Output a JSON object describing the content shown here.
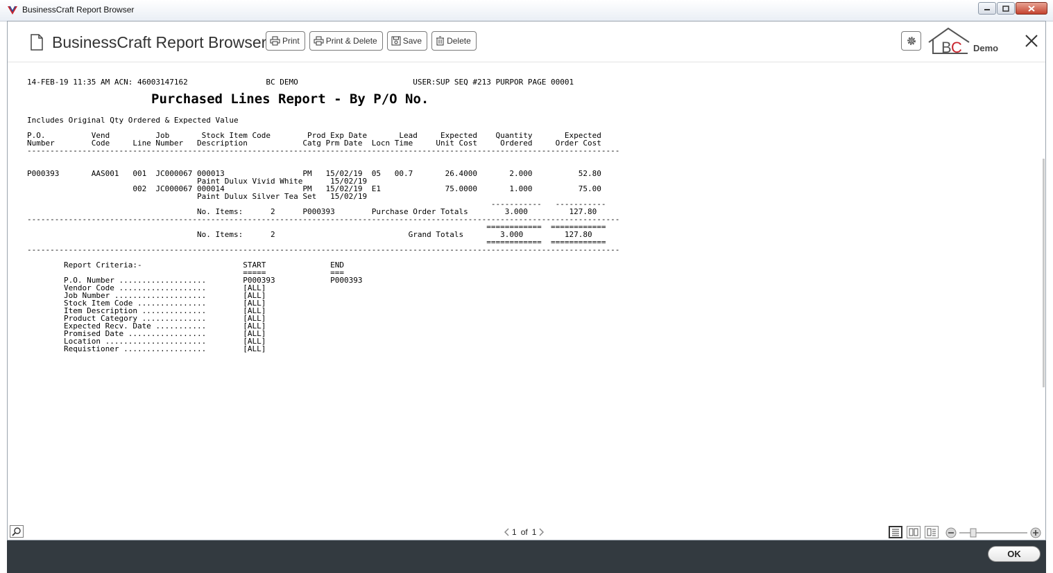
{
  "window": {
    "title": "BusinessCraft Report Browser"
  },
  "header": {
    "app_title": "BusinessCraft Report Browser",
    "toolbar": {
      "print": "Print",
      "print_delete": "Print & Delete",
      "save": "Save",
      "delete": "Delete"
    },
    "logo_text": "Demo",
    "logo_letters": "BC"
  },
  "report": {
    "title": "Purchased Lines Report - By P/O No.",
    "lines": [
      "14-FEB-19 11:35 AM ACN: 46003147162                 BC DEMO                         USER:SUP SEQ #213 PURPOR PAGE 00001",
      "",
      "",
      "",
      "",
      "Includes Original Qty Ordered & Expected Value",
      "",
      "P.O.          Vend          Job       Stock Item Code        Prod Exp Date       Lead     Expected    Quantity       Expected",
      "Number        Code     Line Number   Description            Catg Prm Date  Locn Time     Unit Cost     Ordered     Order Cost",
      "---------------------------------------------------------------------------------------------------------------------------------",
      "",
      "",
      "P000393       AAS001   001  JC000067 000013                 PM   15/02/19  05   00.7       26.4000       2.000          52.80",
      "                                     Paint Dulux Vivid White      15/02/19",
      "                       002  JC000067 000014                 PM   15/02/19  E1              75.0000       1.000          75.00",
      "                                     Paint Dulux Silver Tea Set   15/02/19",
      "                                                                                                     -----------   -----------",
      "                                     No. Items:      2      P000393        Purchase Order Totals        3.000         127.80",
      "---------------------------------------------------------------------------------------------------------------------------------",
      "                                                                                                    ============  ============",
      "                                     No. Items:      2                             Grand Totals        3.000         127.80",
      "                                                                                                    ============  ============",
      "---------------------------------------------------------------------------------------------------------------------------------",
      "",
      "        Report Criteria:-                      START              END",
      "                                               =====              ===",
      "        P.O. Number ...................        P000393            P000393",
      "        Vendor Code ...................        [ALL]",
      "        Job Number ....................        [ALL]",
      "        Stock Item Code ...............        [ALL]",
      "        Item Description ..............        [ALL]",
      "        Product Category ..............        [ALL]",
      "        Expected Recv. Date ...........        [ALL]",
      "        Promised Date .................        [ALL]",
      "        Location ......................        [ALL]",
      "        Requistioner ..................        [ALL]"
    ]
  },
  "statusbar": {
    "page_current": "1",
    "page_of": "of",
    "page_total": "1"
  },
  "footer": {
    "ok": "OK"
  },
  "colors": {
    "bottom_bar": "#333a40",
    "logo_red": "#c8232c"
  }
}
